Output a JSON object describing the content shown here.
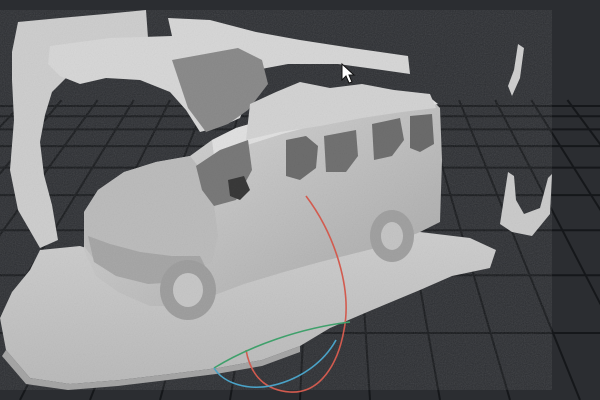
{
  "app": {
    "view": "3d-viewport"
  },
  "colors": {
    "background": "#2b2d31",
    "grid_line": "#15171a",
    "mesh_light": "#d6d6d6",
    "mesh_mid": "#bdbdbd",
    "mesh_dark": "#8a8a8a",
    "gizmo_red": "#d25b4f",
    "gizmo_green": "#3fa06b",
    "gizmo_blue": "#4aa3c8",
    "cursor": "#ffffff"
  },
  "icons": {
    "cursor": "mouse-pointer-icon",
    "gizmo": "rotate-gizmo-icon"
  },
  "scene": {
    "object": "scanned-van-mesh",
    "grid": true
  }
}
